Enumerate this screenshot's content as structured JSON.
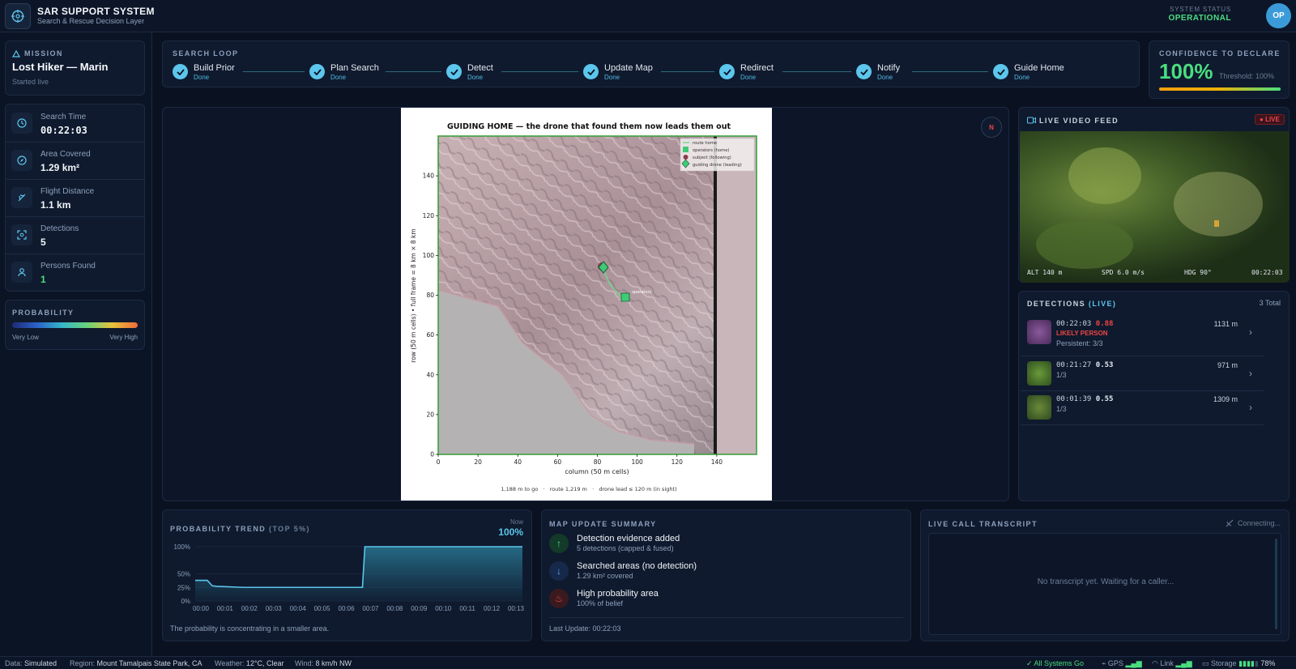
{
  "header": {
    "title": "SAR SUPPORT SYSTEM",
    "subtitle": "Search & Rescue Decision Layer",
    "status_label": "SYSTEM STATUS",
    "status_value": "OPERATIONAL",
    "avatar": "OP"
  },
  "mission": {
    "label": "MISSION",
    "name": "Lost Hiker — Marin",
    "started": "Started live"
  },
  "stats": [
    {
      "label": "Search Time",
      "value": "00:22:03",
      "icon": "clock-icon"
    },
    {
      "label": "Area Covered",
      "value": "1.29 km²",
      "icon": "compass-icon"
    },
    {
      "label": "Flight Distance",
      "value": "1.1 km",
      "icon": "plane-icon"
    },
    {
      "label": "Detections",
      "value": "5",
      "icon": "scan-icon"
    },
    {
      "label": "Persons Found",
      "value": "1",
      "icon": "person-icon"
    }
  ],
  "probability_legend": {
    "label": "PROBABILITY",
    "low": "Very Low",
    "high": "Very High"
  },
  "search_loop": {
    "label": "SEARCH LOOP",
    "steps": [
      {
        "name": "Build Prior",
        "status": "Done"
      },
      {
        "name": "Plan Search",
        "status": "Done"
      },
      {
        "name": "Detect",
        "status": "Done"
      },
      {
        "name": "Update Map",
        "status": "Done"
      },
      {
        "name": "Redirect",
        "status": "Done"
      },
      {
        "name": "Notify",
        "status": "Done"
      },
      {
        "name": "Guide Home",
        "status": "Done"
      }
    ]
  },
  "confidence": {
    "label": "CONFIDENCE TO DECLARE",
    "value": "100%",
    "threshold": "Threshold: 100%",
    "fraction": 1.0
  },
  "map": {
    "compass": "N",
    "title": "GUIDING HOME — the drone that found them now leads them out",
    "xlabel": "column (50 m cells)",
    "ylabel": "row (50 m cells)  •  full frame = 8 km × 8 km",
    "xticks": [
      "0",
      "20",
      "40",
      "60",
      "80",
      "100",
      "120",
      "140"
    ],
    "yticks": [
      "0",
      "20",
      "40",
      "60",
      "80",
      "100",
      "120",
      "140"
    ],
    "legend": [
      "route home",
      "operators (home)",
      "subject (following)",
      "guiding drone (leading)"
    ],
    "operators_label": "operators",
    "footer": "1,188 m to go   ·   route 1,219 m   ·   drone lead ≤ 120 m (in sight)"
  },
  "video": {
    "label": "LIVE VIDEO FEED",
    "live": "LIVE",
    "alt": "ALT 140 m",
    "spd": "SPD 6.0 m/s",
    "hdg": "HDG 90°",
    "time": "00:22:03"
  },
  "detections": {
    "label": "DETECTIONS",
    "live": "(LIVE)",
    "total": "3 Total",
    "items": [
      {
        "time": "00:22:03",
        "score": "0.88",
        "dist": "1131 m",
        "tag": "LIKELY PERSON",
        "sub": "Persistent: 3/3",
        "color": "#ef4444"
      },
      {
        "time": "00:21:27",
        "score": "0.53",
        "dist": "971 m",
        "tag": "",
        "sub": "1/3",
        "color": "#e2e8f0"
      },
      {
        "time": "00:01:39",
        "score": "0.55",
        "dist": "1309 m",
        "tag": "",
        "sub": "1/3",
        "color": "#e2e8f0"
      }
    ]
  },
  "trend": {
    "label": "PROBABILITY TREND",
    "label2": "(TOP 5%)",
    "now_label": "Now",
    "now_value": "100%",
    "yticks": [
      "100%",
      "50%",
      "25%",
      "0%"
    ],
    "xticks": [
      "00:00",
      "00:01",
      "00:02",
      "00:03",
      "00:04",
      "00:05",
      "00:06",
      "00:07",
      "00:08",
      "00:09",
      "00:10",
      "00:11",
      "00:12",
      "00:13"
    ],
    "caption": "The probability is concentrating in a smaller area.",
    "chart_data": {
      "type": "area",
      "x": [
        0,
        0.5,
        0.7,
        0.9,
        2.0,
        6.9,
        7.0,
        13.5
      ],
      "y": [
        0.38,
        0.38,
        0.28,
        0.27,
        0.25,
        0.25,
        1.0,
        1.0
      ],
      "ylim": [
        0,
        1
      ]
    }
  },
  "summary": {
    "label": "MAP UPDATE SUMMARY",
    "items": [
      {
        "title": "Detection evidence added",
        "sub": "5 detections (capped & fused)",
        "icon": "arrow-up-icon"
      },
      {
        "title": "Searched areas (no detection)",
        "sub": "1.29 km² covered",
        "icon": "arrow-down-icon"
      },
      {
        "title": "High probability area",
        "sub": "100% of belief",
        "icon": "flame-icon"
      }
    ],
    "last_update": "Last Update: 00:22:03"
  },
  "transcript": {
    "label": "LIVE CALL TRANSCRIPT",
    "status": "Connecting...",
    "empty": "No transcript yet. Waiting for a caller..."
  },
  "footer": {
    "data_k": "Data:",
    "data_v": "Simulated",
    "region_k": "Region:",
    "region_v": "Mount Tamalpais State Park, CA",
    "weather_k": "Weather:",
    "weather_v": "12°C, Clear",
    "wind_k": "Wind:",
    "wind_v": "8 km/h NW",
    "systems": "All Systems Go",
    "gps": "GPS",
    "link": "Link",
    "storage": "Storage",
    "storage_pct": "78%"
  }
}
